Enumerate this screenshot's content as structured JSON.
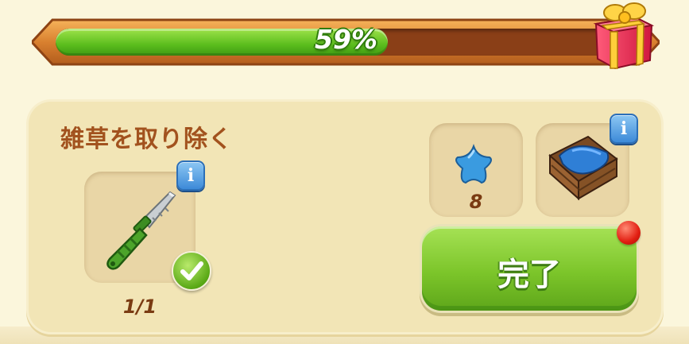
{
  "progress": {
    "percent": 59,
    "label": "59%"
  },
  "reward": {
    "icon": "gift-box-icon"
  },
  "task": {
    "title": "雑草を取り除く",
    "tool": {
      "icon": "knife-icon",
      "count_label": "1/1",
      "completed": true
    },
    "rewards": [
      {
        "icon": "blue-star-icon",
        "count_label": "8"
      },
      {
        "icon": "crate-of-blue-fabric-icon"
      }
    ],
    "complete_button_label": "完了"
  },
  "colors": {
    "progress_fill": "#5bbd1d",
    "progress_track": "#8a3f17",
    "title": "#a2521e",
    "button": "#7cc52a",
    "notification": "#e21f12"
  }
}
